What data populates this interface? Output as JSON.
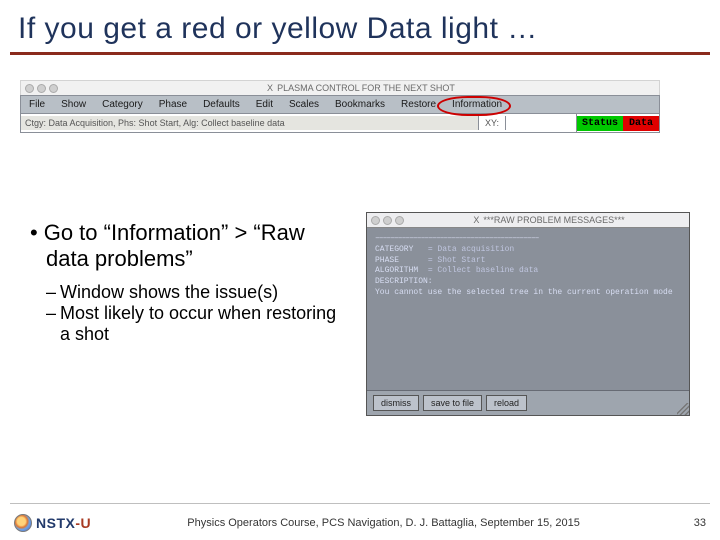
{
  "title": "If you get a red or yellow Data light …",
  "window1": {
    "title": "PLASMA CONTROL FOR THE NEXT SHOT",
    "menu": [
      "File",
      "Show",
      "Category",
      "Phase",
      "Defaults",
      "Edit",
      "Scales",
      "Bookmarks",
      "Restore",
      "Information"
    ],
    "status_left": "Ctgy: Data Acquisition,  Phs: Shot Start,  Alg: Collect baseline data",
    "xy_label": "XY:",
    "status_indicator": "Status",
    "data_indicator": "Data"
  },
  "bullets": {
    "main": "Go to “Information” > “Raw data problems”",
    "subs": [
      "Window shows the issue(s)",
      "Most likely to occur when restoring a shot"
    ]
  },
  "popup": {
    "title": "***RAW PROBLEM MESSAGES***",
    "separator": "–––––––––––––––––––––––––––––––––––––––––––",
    "rows": [
      {
        "label": "CATEGORY   ",
        "value": "= Data acquisition"
      },
      {
        "label": "PHASE      ",
        "value": "= Shot Start"
      },
      {
        "label": "ALGORITHM  ",
        "value": "= Collect baseline data"
      }
    ],
    "desc_label": "DESCRIPTION:",
    "desc_text": "You cannot use the selected tree in the current operation mode",
    "buttons": [
      "dismiss",
      "save to file",
      "reload"
    ]
  },
  "footer": {
    "logo_text_a": "NSTX",
    "logo_text_b": "-U",
    "center": "Physics Operators Course, PCS Navigation, D. J. Battaglia, September 15, 2015",
    "page": "33"
  }
}
